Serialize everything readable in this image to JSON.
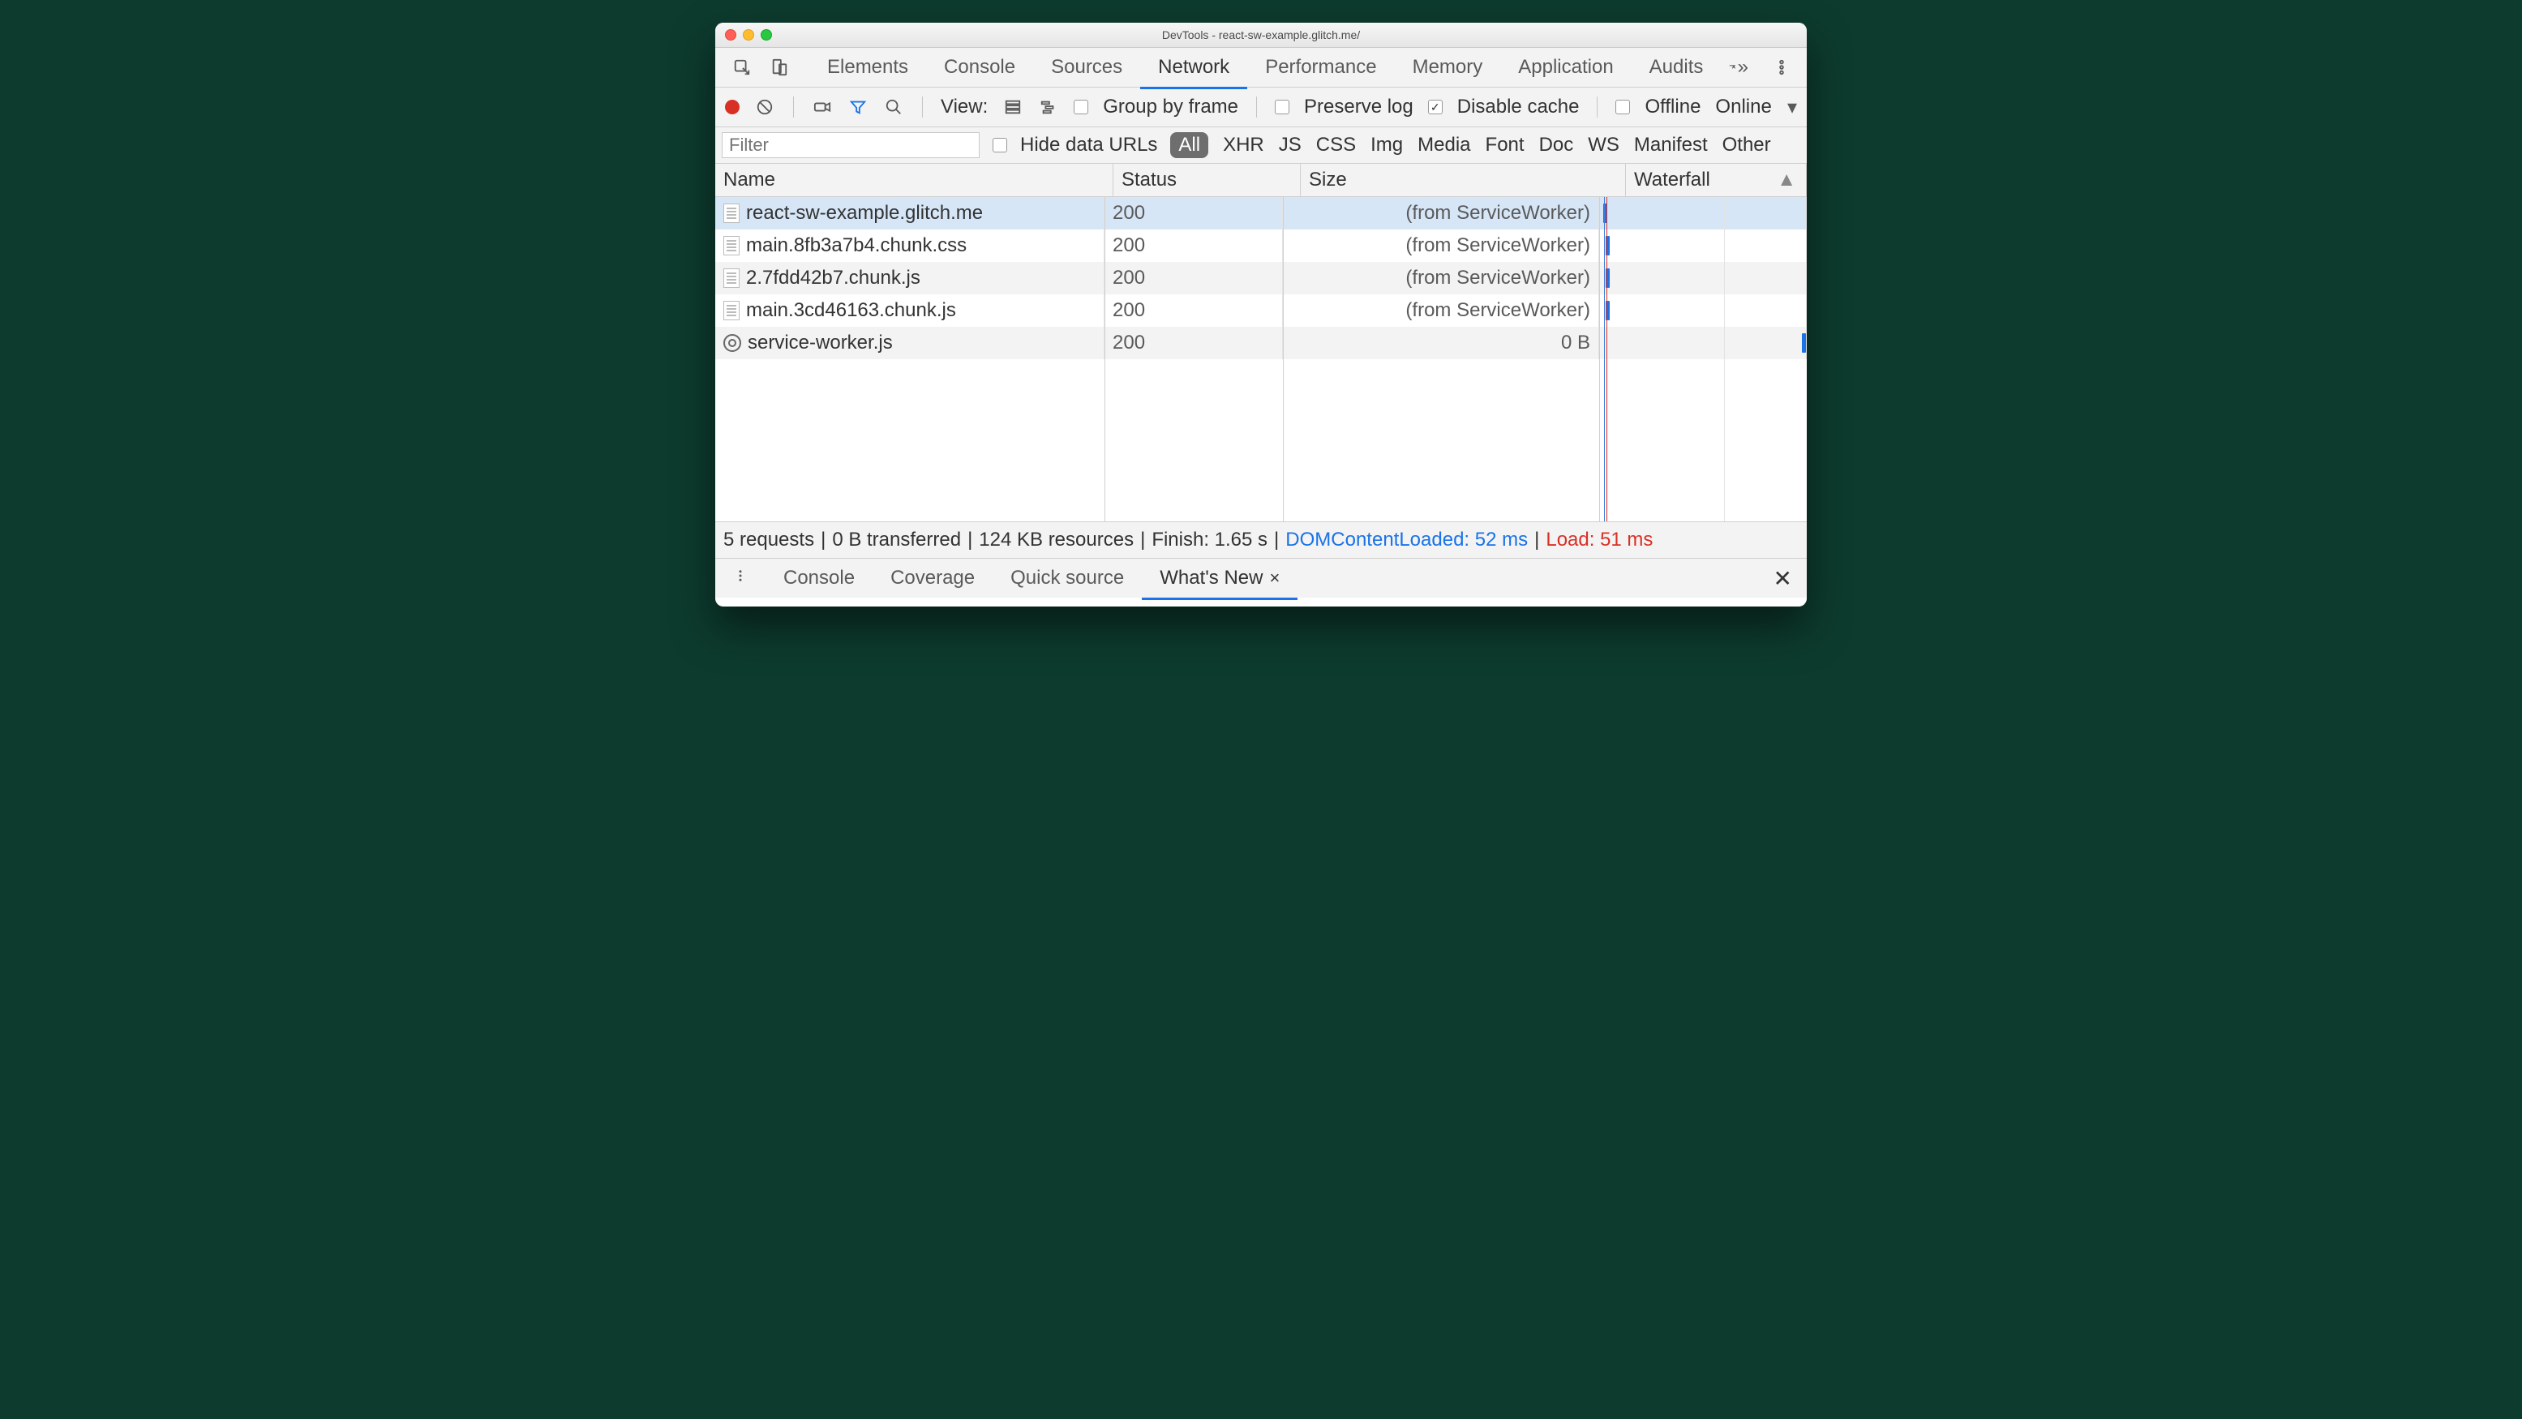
{
  "window": {
    "title": "DevTools - react-sw-example.glitch.me/"
  },
  "main_tabs": {
    "items": [
      "Elements",
      "Console",
      "Sources",
      "Network",
      "Performance",
      "Memory",
      "Application",
      "Audits"
    ],
    "active_index": 3
  },
  "toolbar": {
    "view_label": "View:",
    "group_by_frame": "Group by frame",
    "preserve_log": "Preserve log",
    "disable_cache": "Disable cache",
    "offline": "Offline",
    "online": "Online",
    "disable_cache_checked": true
  },
  "filter": {
    "placeholder": "Filter",
    "hide_data_urls": "Hide data URLs",
    "types": [
      "All",
      "XHR",
      "JS",
      "CSS",
      "Img",
      "Media",
      "Font",
      "Doc",
      "WS",
      "Manifest",
      "Other"
    ],
    "active_type_index": 0
  },
  "columns": {
    "name": "Name",
    "status": "Status",
    "size": "Size",
    "waterfall": "Waterfall"
  },
  "requests": [
    {
      "name": "react-sw-example.glitch.me",
      "status": "200",
      "size": "(from ServiceWorker)",
      "icon": "file",
      "selected": true,
      "wf_left_pct": 2
    },
    {
      "name": "main.8fb3a7b4.chunk.css",
      "status": "200",
      "size": "(from ServiceWorker)",
      "icon": "file",
      "selected": false,
      "wf_left_pct": 3
    },
    {
      "name": "2.7fdd42b7.chunk.js",
      "status": "200",
      "size": "(from ServiceWorker)",
      "icon": "file",
      "selected": false,
      "wf_left_pct": 3
    },
    {
      "name": "main.3cd46163.chunk.js",
      "status": "200",
      "size": "(from ServiceWorker)",
      "icon": "file",
      "selected": false,
      "wf_left_pct": 3
    },
    {
      "name": "service-worker.js",
      "status": "200",
      "size": "0 B",
      "icon": "gear",
      "selected": false,
      "wf_left_pct": 98
    }
  ],
  "status_bar": {
    "requests": "5 requests",
    "transferred": "0 B transferred",
    "resources": "124 KB resources",
    "finish": "Finish: 1.65 s",
    "dcl": "DOMContentLoaded: 52 ms",
    "load": "Load: 51 ms",
    "sep": " | "
  },
  "drawer": {
    "items": [
      "Console",
      "Coverage",
      "Quick source",
      "What's New"
    ],
    "active_index": 3
  }
}
